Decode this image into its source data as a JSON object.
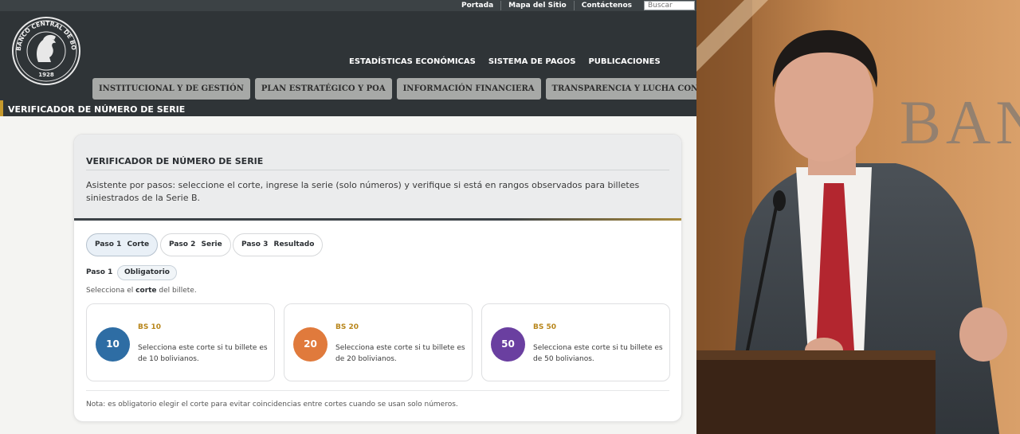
{
  "topbar": {
    "links": [
      "Portada",
      "Mapa del Sitio",
      "Contáctenos"
    ],
    "search_placeholder": "Buscar"
  },
  "header": {
    "logo_text": "BANCO CENTRAL DE BOLIVIA",
    "logo_year": "1928",
    "main_nav": [
      "ESTADÍSTICAS ECONÓMICAS",
      "SISTEMA DE PAGOS",
      "PUBLICACIONES"
    ],
    "tabs": [
      "INSTITUCIONAL Y DE GESTIÓN",
      "PLAN ESTRATÉGICO Y POA",
      "INFORMACIÓN FINANCIERA",
      "TRANSPARENCIA Y LUCHA CONTRA LA CORRUP"
    ]
  },
  "breadcrumb": "VERIFICADOR DE NÚMERO DE SERIE",
  "card": {
    "title": "VERIFICADOR DE NÚMERO DE SERIE",
    "description": "Asistente por pasos: seleccione el corte, ingrese la serie (solo números) y verifique si está en rangos observados para billetes siniestrados de la Serie B.",
    "steps": [
      {
        "num": "Paso 1",
        "label": "Corte"
      },
      {
        "num": "Paso 2",
        "label": "Serie"
      },
      {
        "num": "Paso 3",
        "label": "Resultado"
      }
    ],
    "step_label": "Paso 1",
    "required_badge": "Obligatorio",
    "hint_pre": "Selecciona el ",
    "hint_bold": "corte",
    "hint_post": " del billete.",
    "options": [
      {
        "value": "10",
        "title": "BS 10",
        "desc": "Selecciona este corte si tu billete es de 10 bolivianos.",
        "color": "#2e6da4"
      },
      {
        "value": "20",
        "title": "BS 20",
        "desc": "Selecciona este corte si tu billete es de 20 bolivianos.",
        "color": "#e07a3c"
      },
      {
        "value": "50",
        "title": "BS 50",
        "desc": "Selecciona este corte si tu billete es de 50 bolivianos.",
        "color": "#6a3fa0"
      }
    ],
    "note": "Nota: es obligatorio elegir el corte para evitar coincidencias entre cortes cuando se usan solo números."
  },
  "photo": {
    "wall_letters": "BANC"
  },
  "colors": {
    "header_bg": "#2f3437",
    "accent_gold": "#c79a2c",
    "tab_bg": "#a7a9a7"
  }
}
